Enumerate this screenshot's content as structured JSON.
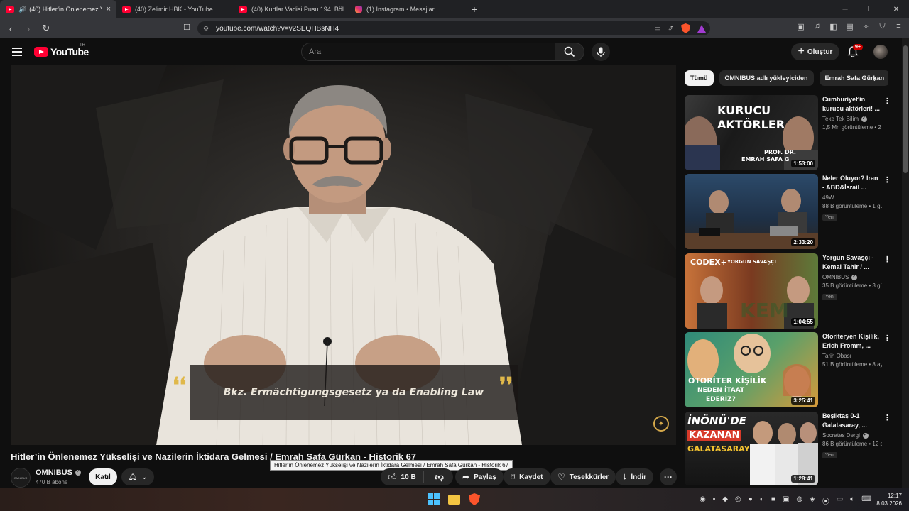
{
  "browser": {
    "tabs": [
      {
        "label": "(40) Hitler’in Önlenemez Yükse",
        "icon": "youtube-icon",
        "active": true
      },
      {
        "label": "(40) Zelimir HBK - YouTube",
        "icon": "youtube-icon",
        "active": false
      },
      {
        "label": "(40) Kurtlar Vadisi Pusu 194. Bölüm",
        "icon": "youtube-icon",
        "active": false
      },
      {
        "label": "(1) Instagram • Mesajlar",
        "icon": "instagram-icon",
        "active": false
      }
    ],
    "url": "youtube.com/watch?v=v2SEQHBsNH4"
  },
  "masthead": {
    "logo_text": "YouTube",
    "country_code": "TR",
    "search_placeholder": "Ara",
    "create_label": "Oluştur",
    "notification_count": "9+"
  },
  "video": {
    "subtitle": "Bkz. Ermächtigungsgesetz ya da Enabling Law",
    "title": "Hitler’in Önlenemez Yükselişi ve Nazilerin İktidara Gelmesi / Emrah Safa Gürkan - Historik 67",
    "tooltip": "Hitler’in Önlenemez Yükselişi ve Nazilerin İktidara Gelmesi / Emrah Safa Gürkan - Historik 67",
    "channel": "OMNIBUS",
    "channel_avatar_text": "OMNIBUS",
    "subscribers": "470 B abone",
    "join_label": "Katıl",
    "likes": "10 B",
    "share_label": "Paylaş",
    "save_label": "Kaydet",
    "thanks_label": "Teşekkürler",
    "download_label": "İndir"
  },
  "sidebar": {
    "chips": [
      "Tümü",
      "OMNIBUS adlı yükleyiciden",
      "Emrah Safa Gürkan"
    ],
    "recommendations": [
      {
        "title": "Cumhuriyet'in kurucu aktörleri! ...",
        "channel": "Teke Tek Bilim",
        "verified": true,
        "meta": "1,5 Mn görüntüleme • 2 yıl önce",
        "badge": "",
        "duration": "1:53:00",
        "thumb_text_1": "KURUCU",
        "thumb_text_2": "AKTÖRLER",
        "thumb_text_3": "PROF. DR.",
        "thumb_text_4": "EMRAH SAFA G"
      },
      {
        "title": "Neler Oluyor? İran - ABD&İsrail ...",
        "channel": "49W",
        "verified": false,
        "meta": "88 B görüntüleme • 1 gün önce",
        "badge": "Yeni",
        "duration": "2:33:20"
      },
      {
        "title": "Yorgun Savaşçı - Kemal Tahir / ...",
        "channel": "OMNIBUS",
        "verified": true,
        "meta": "35 B görüntüleme • 3 gün önce",
        "badge": "Yeni",
        "duration": "1:04:55",
        "thumb_text_1": "CODEX+",
        "thumb_text_2": "YORGUN SAVAŞÇI"
      },
      {
        "title": "Otoriteryen Kişilik, Erich Fromm, ...",
        "channel": "Tarih Obası",
        "verified": false,
        "meta": "51 B görüntüleme • 8 ay önce",
        "badge": "",
        "duration": "3:25:41",
        "thumb_text_1": "OTORİTER KİŞİLİK",
        "thumb_text_2": "NEDEN İTAAT",
        "thumb_text_3": "EDERİZ?"
      },
      {
        "title": "Beşiktaş 0-1 Galatasaray, ...",
        "channel": "Socrates Dergi",
        "verified": true,
        "meta": "86 B görüntüleme • 12 saat önce",
        "badge": "Yeni",
        "duration": "1:28:41",
        "thumb_text_1": "İNÖNÜ'DE",
        "thumb_text_2": "KAZANAN",
        "thumb_text_3": "GALATASARAY"
      }
    ]
  },
  "taskbar": {
    "time": "12:17",
    "date": "8.03.2026"
  }
}
